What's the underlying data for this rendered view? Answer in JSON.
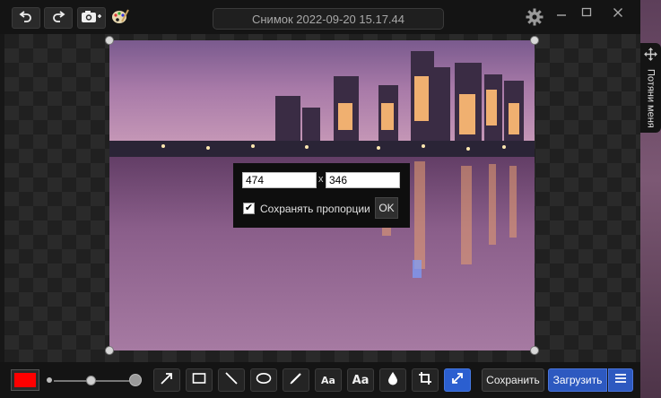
{
  "window": {
    "title": "Снимок 2022-09-20 15.17.44"
  },
  "side_tab": {
    "label": "Потяни меня"
  },
  "resize_dialog": {
    "width_value": "474",
    "height_value": "346",
    "separator": "x",
    "keep_proportions_label": "Сохранять пропорции",
    "keep_proportions_checked": true,
    "ok_label": "OK"
  },
  "toolbar": {
    "color": "#ff0000",
    "text_tool_label": "Aa",
    "text_bg_tool_label": "Aa",
    "save_label": "Сохранить",
    "upload_label": "Загрузить"
  },
  "colors": {
    "accent": "#2d59c0",
    "window_bg": "#171717"
  },
  "icons": [
    "undo-icon",
    "redo-icon",
    "camera-icon",
    "palette-icon",
    "gear-icon",
    "minimize-icon",
    "maximize-icon",
    "close-icon",
    "move-icon",
    "arrow-icon",
    "rectangle-icon",
    "line-icon",
    "ellipse-icon",
    "pen-icon",
    "drop-icon",
    "crop-icon",
    "resize-icon",
    "menu-icon"
  ]
}
